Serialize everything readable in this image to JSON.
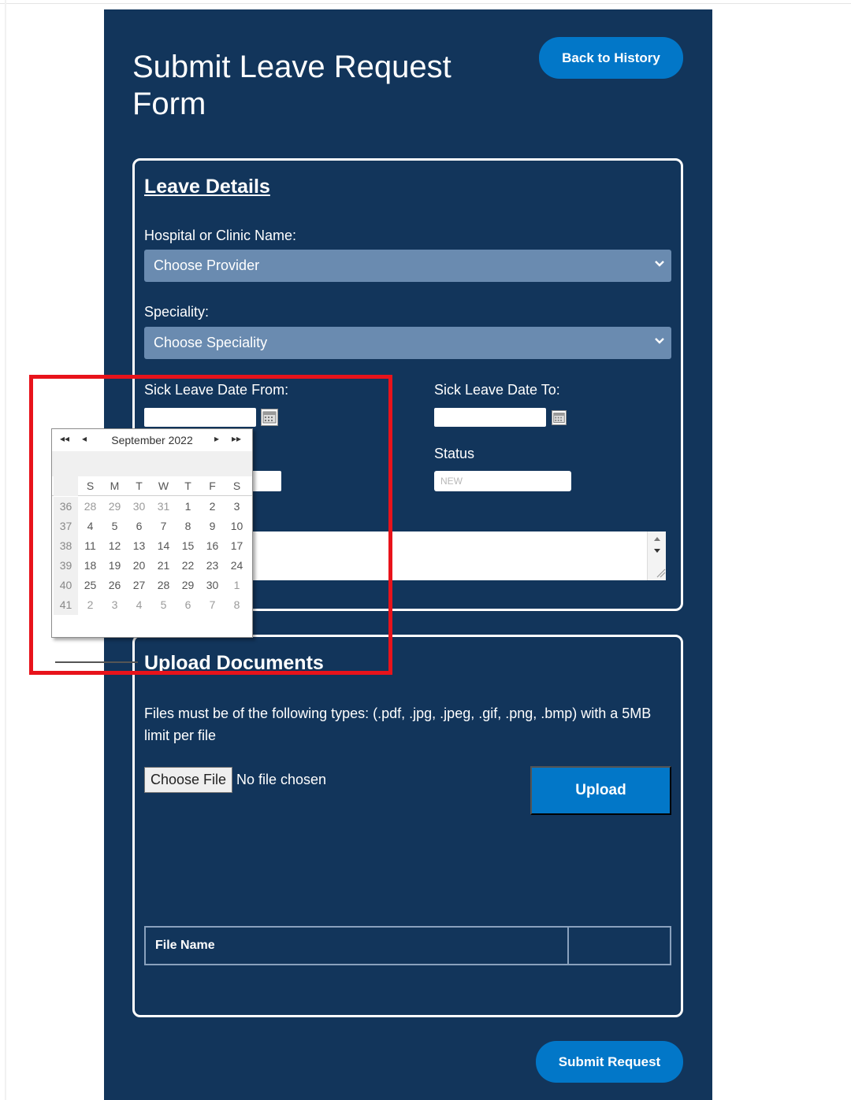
{
  "page": {
    "title": "Submit Leave Request Form",
    "back_button": "Back to History",
    "submit_button": "Submit Request"
  },
  "leave_details": {
    "heading": "Leave Details",
    "hospital_label": "Hospital or Clinic Name:",
    "hospital_select": "Choose Provider",
    "speciality_label": "Speciality:",
    "speciality_select": "Choose Speciality",
    "date_from_label": "Sick Leave Date From:",
    "date_to_label": "Sick Leave Date To:",
    "status_label": "Status",
    "status_value": "NEW"
  },
  "calendar": {
    "month_label": "September 2022",
    "nav": {
      "prev_year": "◂◂",
      "prev_month": "◂",
      "next_month": "▸",
      "next_year": "▸▸"
    },
    "weekdays": [
      "S",
      "M",
      "T",
      "W",
      "T",
      "F",
      "S"
    ],
    "weeks": [
      {
        "week": "36",
        "days": [
          "28",
          "29",
          "30",
          "31",
          "1",
          "2",
          "3"
        ]
      },
      {
        "week": "37",
        "days": [
          "4",
          "5",
          "6",
          "7",
          "8",
          "9",
          "10"
        ]
      },
      {
        "week": "38",
        "days": [
          "11",
          "12",
          "13",
          "14",
          "15",
          "16",
          "17"
        ]
      },
      {
        "week": "39",
        "days": [
          "18",
          "19",
          "20",
          "21",
          "22",
          "23",
          "24"
        ]
      },
      {
        "week": "40",
        "days": [
          "25",
          "26",
          "27",
          "28",
          "29",
          "30",
          "1"
        ]
      },
      {
        "week": "41",
        "days": [
          "2",
          "3",
          "4",
          "5",
          "6",
          "7",
          "8"
        ]
      }
    ]
  },
  "upload": {
    "heading": "Upload Documents",
    "note": "Files must be of the following types: (.pdf, .jpg, .jpeg, .gif, .png, .bmp) with a 5MB limit per file",
    "choose_file": "Choose File",
    "no_file": "No file chosen",
    "upload_button": "Upload",
    "table_header": "File Name"
  },
  "colors": {
    "panel": "#12355b",
    "accent": "#0277c8",
    "select_bg": "#6a8bb0",
    "highlight": "#e8131b"
  }
}
